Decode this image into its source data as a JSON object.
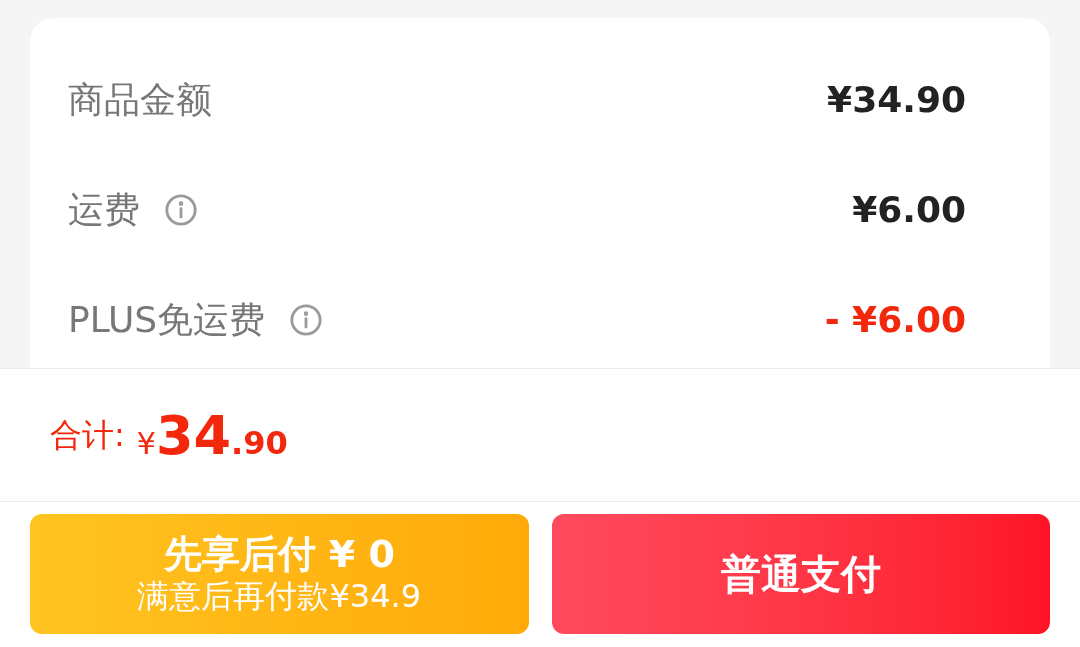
{
  "fees": [
    {
      "label": "商品金额",
      "info": false,
      "value": "¥34.90",
      "kind": "charge"
    },
    {
      "label": "运费",
      "info": true,
      "value": "¥6.00",
      "kind": "charge"
    },
    {
      "label": "PLUS免运费",
      "info": true,
      "value": "- ¥6.00",
      "kind": "discount"
    }
  ],
  "total": {
    "label": "合计:",
    "currency": "¥",
    "integer": "34",
    "decimal": ".90"
  },
  "buttons": [
    {
      "kind": "pay_later",
      "title": "先享后付 ¥ 0",
      "subtitle": "满意后再付款¥34.9"
    },
    {
      "kind": "pay_now",
      "title": "普通支付"
    }
  ]
}
